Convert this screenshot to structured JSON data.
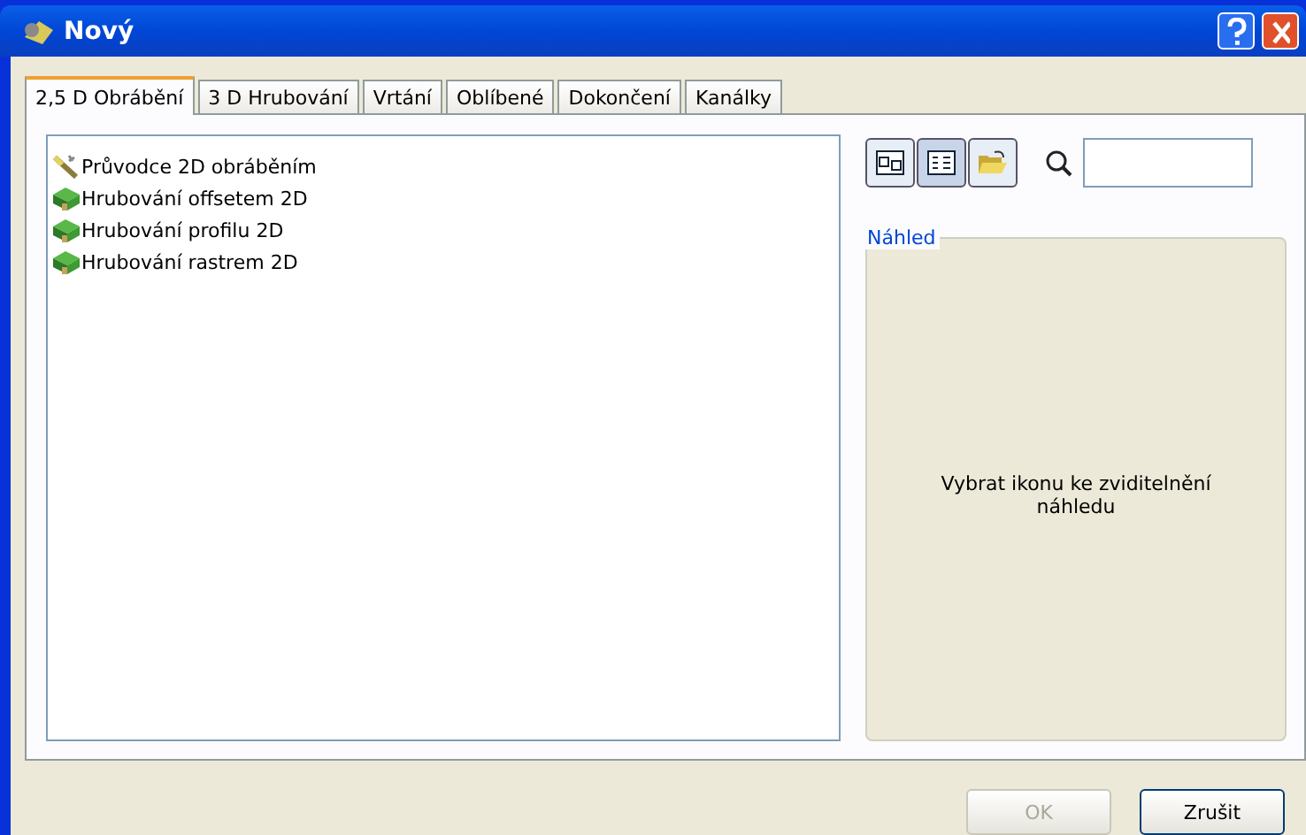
{
  "window": {
    "title": "Nový"
  },
  "tabs": [
    {
      "label": "2,5 D Obrábění",
      "selected": true
    },
    {
      "label": "3 D Hrubování",
      "selected": false
    },
    {
      "label": "Vrtání",
      "selected": false
    },
    {
      "label": "Oblíbené",
      "selected": false
    },
    {
      "label": "Dokončení",
      "selected": false
    },
    {
      "label": "Kanálky",
      "selected": false
    }
  ],
  "items": [
    {
      "label": "Průvodce 2D obráběním",
      "kind": "wizard"
    },
    {
      "label": "Hrubování offsetem 2D",
      "kind": "block"
    },
    {
      "label": "Hrubování profilu 2D",
      "kind": "block"
    },
    {
      "label": "Hrubování rastrem 2D",
      "kind": "block"
    }
  ],
  "toolbar": [
    {
      "kind": "large-icons",
      "selected": false
    },
    {
      "kind": "list",
      "selected": true
    },
    {
      "kind": "folder",
      "selected": false
    }
  ],
  "preview": {
    "title": "Náhled",
    "message": "Vybrat ikonu ke zviditelnění náhledu"
  },
  "buttons": [
    {
      "label": "OK",
      "disabled": true
    },
    {
      "label": "Zrušit",
      "disabled": false
    }
  ]
}
